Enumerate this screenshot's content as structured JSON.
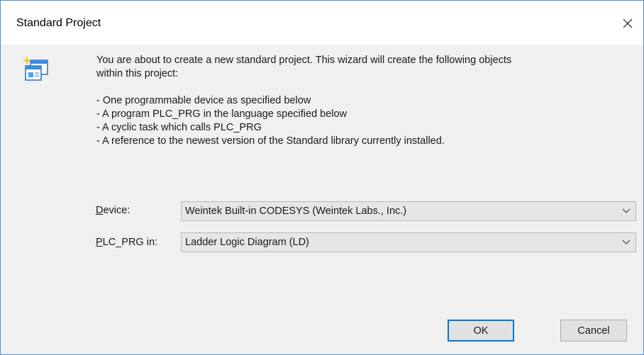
{
  "window": {
    "title": "Standard Project"
  },
  "icons": {
    "close": "close-icon",
    "wizard": "new-project-wizard-icon",
    "dropdown": "chevron-down-icon"
  },
  "description": {
    "intro_line1": "You are about to create a new standard project. This wizard will create the following objects",
    "intro_line2": "within this project:",
    "items": [
      "- One programmable device as specified below",
      "- A program PLC_PRG in the language specified below",
      "- A cyclic task which calls PLC_PRG",
      "- A reference to the newest version of the Standard library currently installed."
    ]
  },
  "form": {
    "device": {
      "label_mnemonic": "D",
      "label_rest": "evice:",
      "value": "Weintek Built-in CODESYS (Weintek Labs., Inc.)"
    },
    "plc_prg": {
      "label_mnemonic": "P",
      "label_rest": "LC_PRG in:",
      "value": "Ladder Logic Diagram (LD)"
    }
  },
  "buttons": {
    "ok": "OK",
    "cancel": "Cancel"
  },
  "colors": {
    "window_border": "#4c8fd6",
    "titlebar_bg": "#ffffff",
    "dialog_bg": "#f0f0f0",
    "default_button_border": "#0078d7"
  }
}
